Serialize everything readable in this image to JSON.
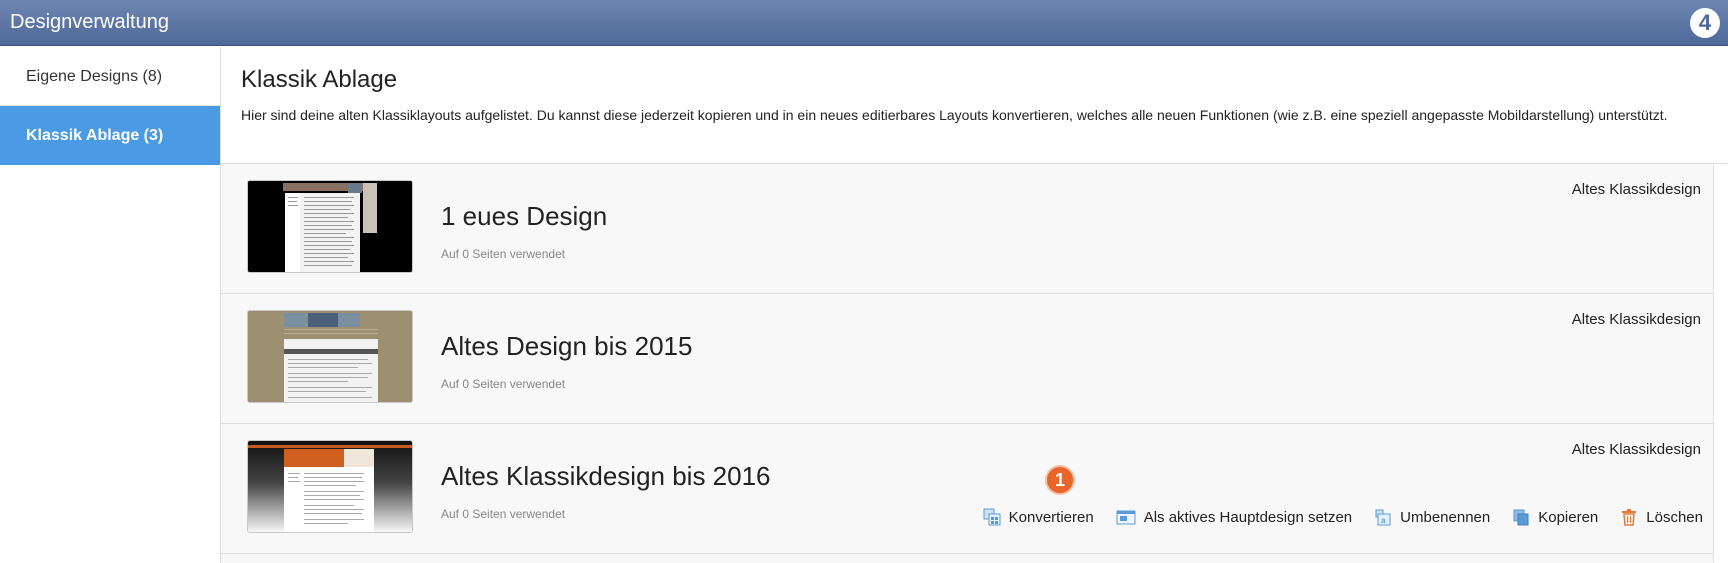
{
  "app": {
    "title": "Designverwaltung",
    "logo_text": "4"
  },
  "sidebar": {
    "items": [
      {
        "label": "Eigene Designs (8)",
        "active": false
      },
      {
        "label": "Klassik Ablage (3)",
        "active": true
      }
    ]
  },
  "main": {
    "title": "Klassik Ablage",
    "description": "Hier sind deine alten Klassiklayouts aufgelistet. Du kannst diese jederzeit kopieren und in ein neues editierbares Layouts konvertieren, welches alle neuen Funktionen (wie z.B. eine speziell angepasste Mobildarstellung) unterstützt."
  },
  "designs": [
    {
      "name": "1 eues Design",
      "usage": "Auf 0 Seiten verwendet",
      "type": "Altes Klassikdesign"
    },
    {
      "name": "Altes Design bis 2015",
      "usage": "Auf 0 Seiten verwendet",
      "type": "Altes Klassikdesign"
    },
    {
      "name": "Altes Klassikdesign bis 2016",
      "usage": "Auf 0 Seiten verwendet",
      "type": "Altes Klassikdesign"
    }
  ],
  "actions": {
    "convert": "Konvertieren",
    "set_main": "Als aktives Hauptdesign setzen",
    "rename": "Umbenennen",
    "copy": "Kopieren",
    "delete": "Löschen"
  },
  "step_badge": "1",
  "colors": {
    "titlebar": "#5a74a4",
    "active_sidebar": "#4a9ae4",
    "badge": "#e8662c",
    "action_icon_blue": "#5b9bd5",
    "delete_icon": "#e07b3a"
  },
  "icons": {
    "convert": "convert-icon",
    "set_main": "layout-icon",
    "rename": "rename-icon",
    "copy": "copy-icon",
    "delete": "trash-icon"
  }
}
